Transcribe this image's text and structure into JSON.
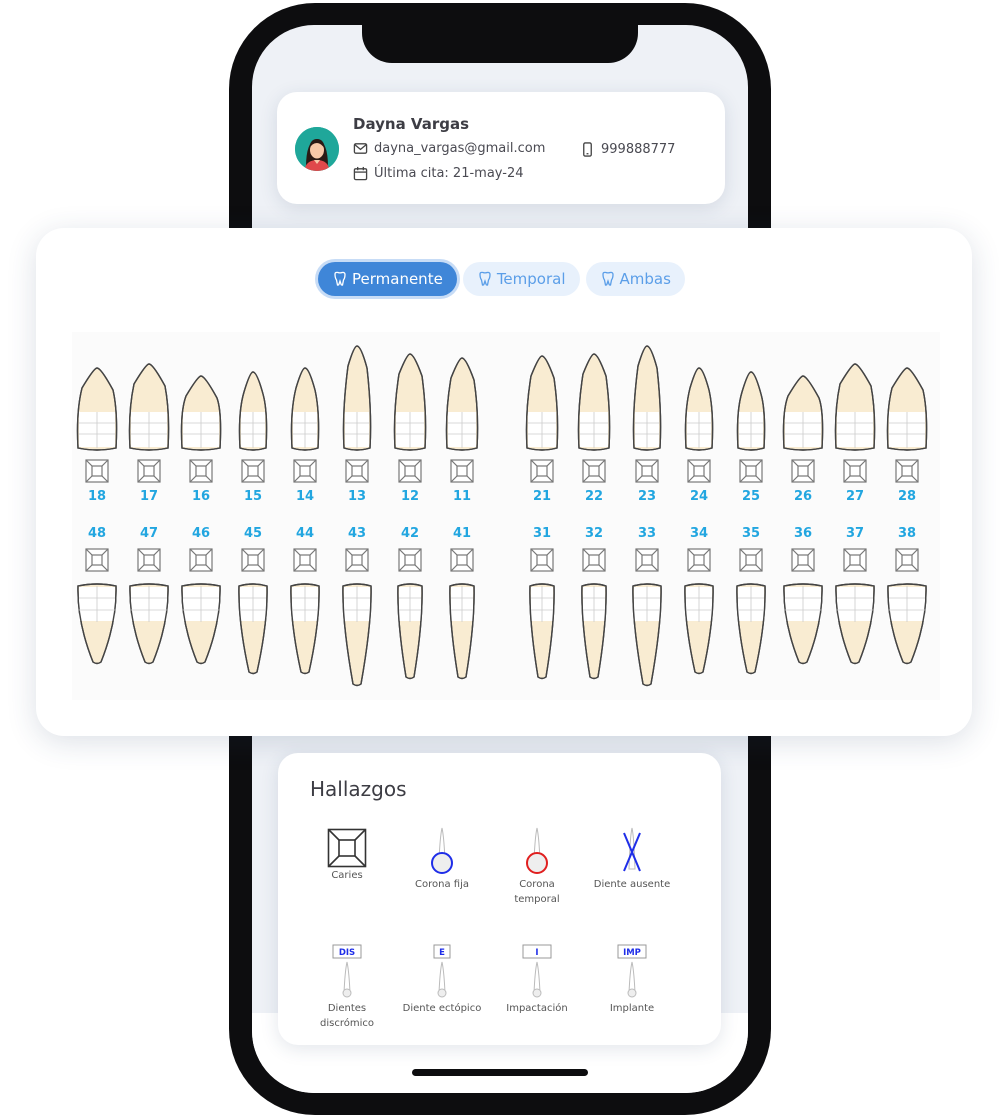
{
  "patient": {
    "name": "Dayna Vargas",
    "email": "dayna_vargas@gmail.com",
    "phone": "999888777",
    "last_visit": "Última cita: 21-may-24"
  },
  "tabs": [
    {
      "label": "Permanente",
      "active": true
    },
    {
      "label": "Temporal",
      "active": false
    },
    {
      "label": "Ambas",
      "active": false
    }
  ],
  "upper_teeth": [
    "18",
    "17",
    "16",
    "15",
    "14",
    "13",
    "12",
    "11",
    "21",
    "22",
    "23",
    "24",
    "25",
    "26",
    "27",
    "28"
  ],
  "lower_teeth": [
    "48",
    "47",
    "46",
    "45",
    "44",
    "43",
    "42",
    "41",
    "31",
    "32",
    "33",
    "34",
    "35",
    "36",
    "37",
    "38"
  ],
  "findings": {
    "title": "Hallazgos",
    "items": [
      {
        "label": "Caries",
        "icon": "caries-icon"
      },
      {
        "label": "Corona fija",
        "icon": "corona-fija-icon",
        "color": "#1f2ee8"
      },
      {
        "label": "Corona temporal",
        "icon": "corona-temporal-icon",
        "color": "#e01f1f"
      },
      {
        "label": "Diente ausente",
        "icon": "diente-ausente-icon",
        "color": "#1f2ee8"
      },
      {
        "label": "Dientes discrómico",
        "icon": "dientes-discromico-icon",
        "tag": "DIS"
      },
      {
        "label": "Diente ectópico",
        "icon": "diente-ectopico-icon",
        "tag": "E"
      },
      {
        "label": "Impactación",
        "icon": "impactacion-icon",
        "tag": "I"
      },
      {
        "label": "Implante",
        "icon": "implante-icon",
        "tag": "IMP"
      }
    ]
  },
  "colors": {
    "accent": "#3f86d8",
    "tooth_number": "#22a6e0",
    "root": "#f9ecd2"
  }
}
